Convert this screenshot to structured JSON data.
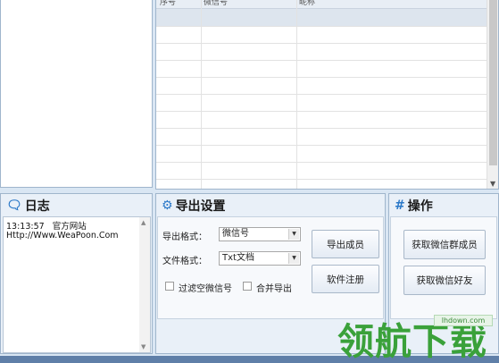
{
  "table": {
    "columns": [
      "序号",
      "微信号",
      "昵称"
    ]
  },
  "log": {
    "title": "日志",
    "lines": [
      {
        "time": "13:13:57",
        "text": "官方网站"
      },
      {
        "text": "Http://Www.WeaPoon.Com"
      }
    ]
  },
  "export": {
    "title": "导出设置",
    "format_label": "导出格式：",
    "format_value": "微信号",
    "file_label": "文件格式：",
    "file_value": "Txt文档",
    "filter_label": "过滤空微信号",
    "merge_label": "合并导出",
    "export_button": "导出成员",
    "register_button": "软件注册"
  },
  "ops": {
    "title": "操作",
    "get_group_button": "获取微信群成员",
    "get_friends_button": "获取微信好友"
  },
  "watermark": {
    "text": "领航下载",
    "url": "lhdown.com"
  }
}
